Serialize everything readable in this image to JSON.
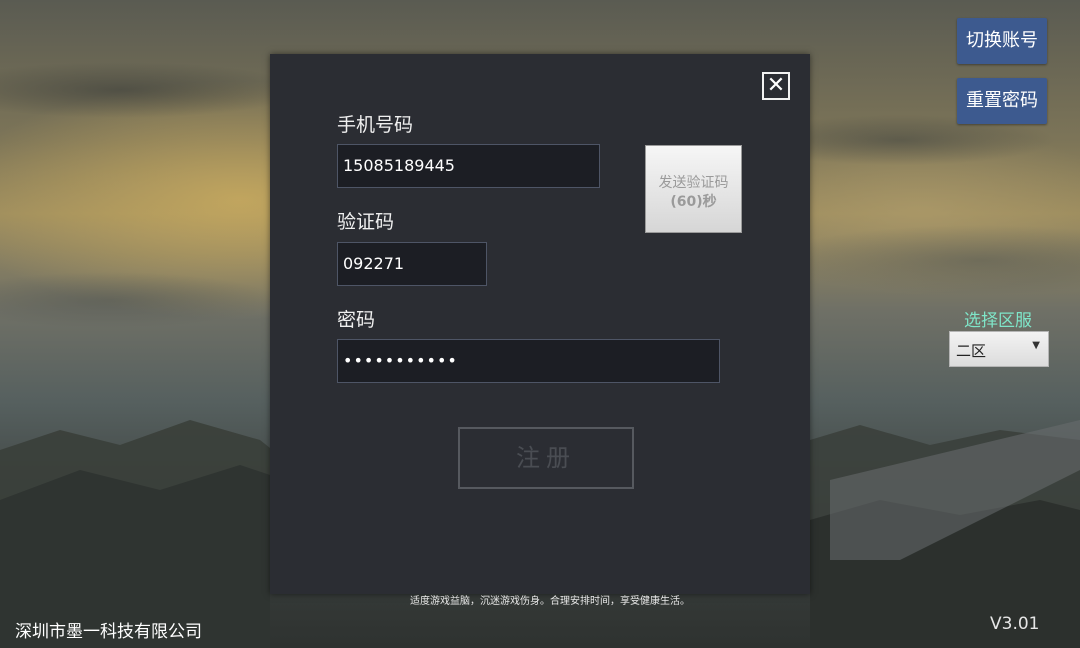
{
  "top_buttons": {
    "switch_account": "切换账号",
    "reset_password": "重置密码"
  },
  "server": {
    "label": "选择区服",
    "selected": "二区"
  },
  "dialog": {
    "phone_label": "手机号码",
    "phone_value": "15085189445",
    "code_label": "验证码",
    "code_value": "092271",
    "password_label": "密码",
    "password_value": "•••••••••••",
    "send_code_line1": "发送验证码",
    "send_code_line2": "(60)秒",
    "register_label": "注册",
    "close_icon": "close-icon"
  },
  "footer": {
    "notice": "适度游戏益脑，沉迷游戏伤身。合理安排时间，享受健康生活。",
    "company": "深圳市墨一科技有限公司",
    "version": "V3.01"
  },
  "colors": {
    "dialog_bg": "#2b2d33",
    "top_button_bg": "#3d5a8f",
    "server_label": "#7fe6c9"
  }
}
